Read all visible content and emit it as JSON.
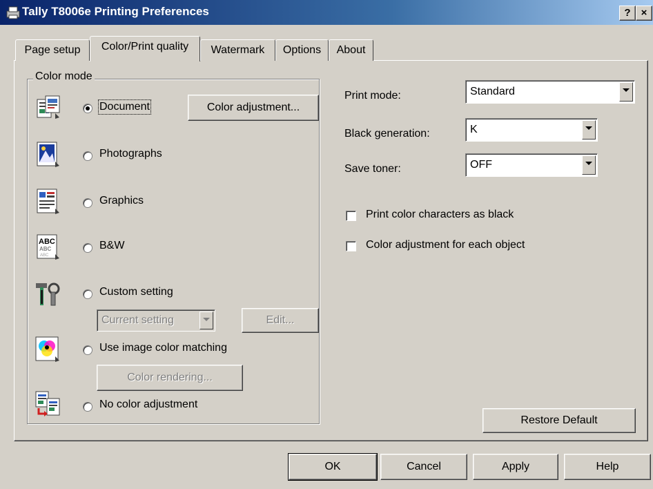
{
  "window": {
    "title": "Tally T8006e Printing Preferences",
    "help_glyph": "?",
    "close_glyph": "×"
  },
  "tabs": [
    {
      "label": "Page setup"
    },
    {
      "label": "Color/Print quality"
    },
    {
      "label": "Watermark"
    },
    {
      "label": "Options"
    },
    {
      "label": "About"
    }
  ],
  "color_mode": {
    "group_label": "Color mode",
    "options": [
      {
        "label": "Document",
        "icon": "document-icon",
        "checked": true
      },
      {
        "label": "Photographs",
        "icon": "photographs-icon",
        "checked": false
      },
      {
        "label": "Graphics",
        "icon": "graphics-icon",
        "checked": false
      },
      {
        "label": "B&W",
        "icon": "bw-icon",
        "checked": false
      },
      {
        "label": "Custom setting",
        "icon": "custom-setting-icon",
        "checked": false
      },
      {
        "label": "Use image color matching",
        "icon": "color-matching-icon",
        "checked": false
      },
      {
        "label": "No color adjustment",
        "icon": "no-color-adjustment-icon",
        "checked": false
      }
    ],
    "color_adjustment_button": "Color adjustment...",
    "custom_setting_combo": "Current setting",
    "edit_button": "Edit...",
    "color_rendering_button": "Color rendering...",
    "bw_icon_text": "ABC"
  },
  "settings": {
    "print_mode": {
      "label": "Print mode:",
      "value": "Standard"
    },
    "black_generation": {
      "label": "Black generation:",
      "value": "K"
    },
    "save_toner": {
      "label": "Save toner:",
      "value": "OFF"
    },
    "print_color_as_black": {
      "label": "Print color characters as black",
      "checked": false
    },
    "color_adjust_each_object": {
      "label": "Color adjustment for each object",
      "checked": false
    }
  },
  "restore_default_button": "Restore Default",
  "footer": {
    "ok": "OK",
    "cancel": "Cancel",
    "apply": "Apply",
    "help": "Help"
  },
  "colors": {
    "titlebar_start": "#0a246a",
    "titlebar_end": "#a6caf0",
    "face": "#d4d0c8"
  }
}
